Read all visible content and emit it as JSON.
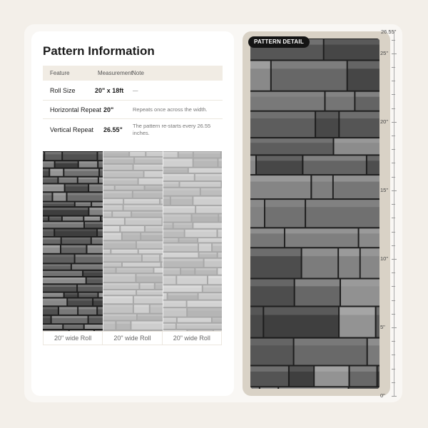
{
  "title": "Pattern Information",
  "table": {
    "headers": {
      "feature": "Feature",
      "measurement": "Measurement",
      "note": "Note"
    },
    "rows": [
      {
        "feature": "Roll Size",
        "measurement": "20\" x 18ft",
        "note": "—"
      },
      {
        "feature": "Horizontal Repeat",
        "measurement": "20\"",
        "note": "Repeats once across the width."
      },
      {
        "feature": "Vertical Repeat",
        "measurement": "26.55\"",
        "note": "The pattern re-starts every 26.55 inches."
      }
    ]
  },
  "rolls": {
    "labels": [
      "20\" wide Roll",
      "20\" wide Roll",
      "20\" wide Roll"
    ]
  },
  "detail": {
    "badge": "PATTERN DETAIL"
  },
  "ruler": {
    "top_label": "26.55\"",
    "labels": [
      {
        "text": "25\"",
        "value": 25
      },
      {
        "text": "20\"",
        "value": 20
      },
      {
        "text": "15\"",
        "value": 15
      },
      {
        "text": "10\"",
        "value": 10
      },
      {
        "text": "5\"",
        "value": 5
      },
      {
        "text": "0\"",
        "value": 0
      }
    ],
    "max": 26.55
  },
  "colors": {
    "background": "#f3efe9",
    "card": "#ffffff",
    "table_header": "#f1ece4",
    "detail_frame": "#d9d2c6",
    "badge": "#141414"
  }
}
